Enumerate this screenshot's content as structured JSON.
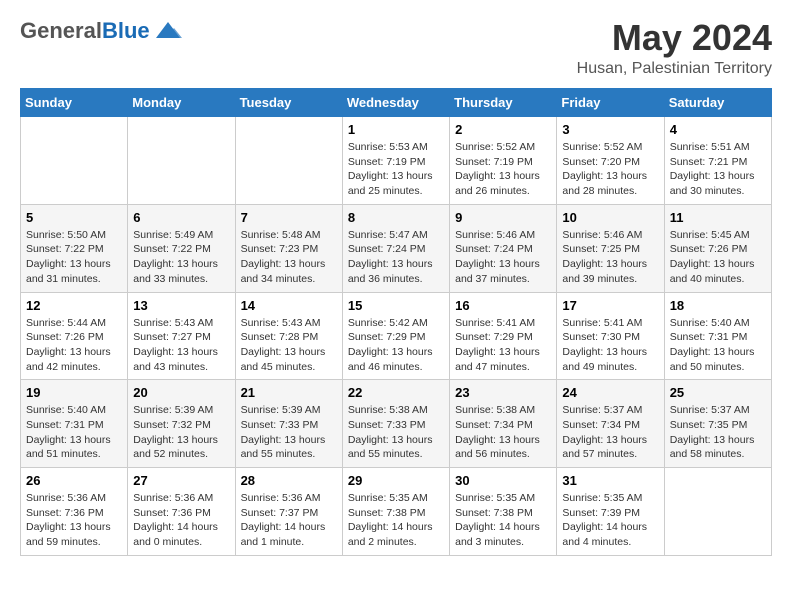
{
  "header": {
    "logo_general": "General",
    "logo_blue": "Blue",
    "month": "May 2024",
    "location": "Husan, Palestinian Territory"
  },
  "days_of_week": [
    "Sunday",
    "Monday",
    "Tuesday",
    "Wednesday",
    "Thursday",
    "Friday",
    "Saturday"
  ],
  "weeks": [
    [
      {
        "day": "",
        "info": ""
      },
      {
        "day": "",
        "info": ""
      },
      {
        "day": "",
        "info": ""
      },
      {
        "day": "1",
        "sunrise": "Sunrise: 5:53 AM",
        "sunset": "Sunset: 7:19 PM",
        "daylight": "Daylight: 13 hours and 25 minutes."
      },
      {
        "day": "2",
        "sunrise": "Sunrise: 5:52 AM",
        "sunset": "Sunset: 7:19 PM",
        "daylight": "Daylight: 13 hours and 26 minutes."
      },
      {
        "day": "3",
        "sunrise": "Sunrise: 5:52 AM",
        "sunset": "Sunset: 7:20 PM",
        "daylight": "Daylight: 13 hours and 28 minutes."
      },
      {
        "day": "4",
        "sunrise": "Sunrise: 5:51 AM",
        "sunset": "Sunset: 7:21 PM",
        "daylight": "Daylight: 13 hours and 30 minutes."
      }
    ],
    [
      {
        "day": "5",
        "sunrise": "Sunrise: 5:50 AM",
        "sunset": "Sunset: 7:22 PM",
        "daylight": "Daylight: 13 hours and 31 minutes."
      },
      {
        "day": "6",
        "sunrise": "Sunrise: 5:49 AM",
        "sunset": "Sunset: 7:22 PM",
        "daylight": "Daylight: 13 hours and 33 minutes."
      },
      {
        "day": "7",
        "sunrise": "Sunrise: 5:48 AM",
        "sunset": "Sunset: 7:23 PM",
        "daylight": "Daylight: 13 hours and 34 minutes."
      },
      {
        "day": "8",
        "sunrise": "Sunrise: 5:47 AM",
        "sunset": "Sunset: 7:24 PM",
        "daylight": "Daylight: 13 hours and 36 minutes."
      },
      {
        "day": "9",
        "sunrise": "Sunrise: 5:46 AM",
        "sunset": "Sunset: 7:24 PM",
        "daylight": "Daylight: 13 hours and 37 minutes."
      },
      {
        "day": "10",
        "sunrise": "Sunrise: 5:46 AM",
        "sunset": "Sunset: 7:25 PM",
        "daylight": "Daylight: 13 hours and 39 minutes."
      },
      {
        "day": "11",
        "sunrise": "Sunrise: 5:45 AM",
        "sunset": "Sunset: 7:26 PM",
        "daylight": "Daylight: 13 hours and 40 minutes."
      }
    ],
    [
      {
        "day": "12",
        "sunrise": "Sunrise: 5:44 AM",
        "sunset": "Sunset: 7:26 PM",
        "daylight": "Daylight: 13 hours and 42 minutes."
      },
      {
        "day": "13",
        "sunrise": "Sunrise: 5:43 AM",
        "sunset": "Sunset: 7:27 PM",
        "daylight": "Daylight: 13 hours and 43 minutes."
      },
      {
        "day": "14",
        "sunrise": "Sunrise: 5:43 AM",
        "sunset": "Sunset: 7:28 PM",
        "daylight": "Daylight: 13 hours and 45 minutes."
      },
      {
        "day": "15",
        "sunrise": "Sunrise: 5:42 AM",
        "sunset": "Sunset: 7:29 PM",
        "daylight": "Daylight: 13 hours and 46 minutes."
      },
      {
        "day": "16",
        "sunrise": "Sunrise: 5:41 AM",
        "sunset": "Sunset: 7:29 PM",
        "daylight": "Daylight: 13 hours and 47 minutes."
      },
      {
        "day": "17",
        "sunrise": "Sunrise: 5:41 AM",
        "sunset": "Sunset: 7:30 PM",
        "daylight": "Daylight: 13 hours and 49 minutes."
      },
      {
        "day": "18",
        "sunrise": "Sunrise: 5:40 AM",
        "sunset": "Sunset: 7:31 PM",
        "daylight": "Daylight: 13 hours and 50 minutes."
      }
    ],
    [
      {
        "day": "19",
        "sunrise": "Sunrise: 5:40 AM",
        "sunset": "Sunset: 7:31 PM",
        "daylight": "Daylight: 13 hours and 51 minutes."
      },
      {
        "day": "20",
        "sunrise": "Sunrise: 5:39 AM",
        "sunset": "Sunset: 7:32 PM",
        "daylight": "Daylight: 13 hours and 52 minutes."
      },
      {
        "day": "21",
        "sunrise": "Sunrise: 5:39 AM",
        "sunset": "Sunset: 7:33 PM",
        "daylight": "Daylight: 13 hours and 55 minutes."
      },
      {
        "day": "22",
        "sunrise": "Sunrise: 5:38 AM",
        "sunset": "Sunset: 7:33 PM",
        "daylight": "Daylight: 13 hours and 55 minutes."
      },
      {
        "day": "23",
        "sunrise": "Sunrise: 5:38 AM",
        "sunset": "Sunset: 7:34 PM",
        "daylight": "Daylight: 13 hours and 56 minutes."
      },
      {
        "day": "24",
        "sunrise": "Sunrise: 5:37 AM",
        "sunset": "Sunset: 7:34 PM",
        "daylight": "Daylight: 13 hours and 57 minutes."
      },
      {
        "day": "25",
        "sunrise": "Sunrise: 5:37 AM",
        "sunset": "Sunset: 7:35 PM",
        "daylight": "Daylight: 13 hours and 58 minutes."
      }
    ],
    [
      {
        "day": "26",
        "sunrise": "Sunrise: 5:36 AM",
        "sunset": "Sunset: 7:36 PM",
        "daylight": "Daylight: 13 hours and 59 minutes."
      },
      {
        "day": "27",
        "sunrise": "Sunrise: 5:36 AM",
        "sunset": "Sunset: 7:36 PM",
        "daylight": "Daylight: 14 hours and 0 minutes."
      },
      {
        "day": "28",
        "sunrise": "Sunrise: 5:36 AM",
        "sunset": "Sunset: 7:37 PM",
        "daylight": "Daylight: 14 hours and 1 minute."
      },
      {
        "day": "29",
        "sunrise": "Sunrise: 5:35 AM",
        "sunset": "Sunset: 7:38 PM",
        "daylight": "Daylight: 14 hours and 2 minutes."
      },
      {
        "day": "30",
        "sunrise": "Sunrise: 5:35 AM",
        "sunset": "Sunset: 7:38 PM",
        "daylight": "Daylight: 14 hours and 3 minutes."
      },
      {
        "day": "31",
        "sunrise": "Sunrise: 5:35 AM",
        "sunset": "Sunset: 7:39 PM",
        "daylight": "Daylight: 14 hours and 4 minutes."
      },
      {
        "day": "",
        "info": ""
      }
    ]
  ]
}
